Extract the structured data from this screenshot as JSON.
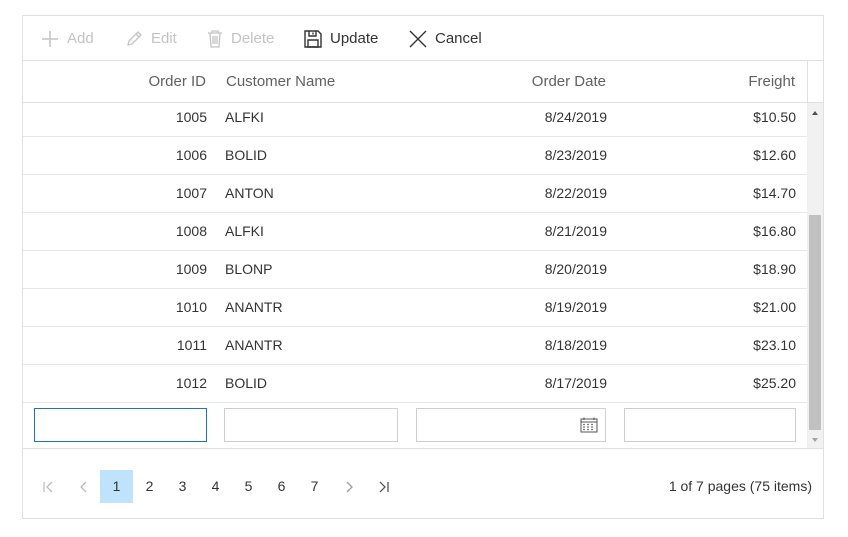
{
  "toolbar": {
    "add_label": "Add",
    "edit_label": "Edit",
    "delete_label": "Delete",
    "update_label": "Update",
    "cancel_label": "Cancel"
  },
  "columns": {
    "order_id": "Order ID",
    "customer_name": "Customer Name",
    "order_date": "Order Date",
    "freight": "Freight"
  },
  "rows": [
    {
      "id": "1005",
      "customer": "ALFKI",
      "date": "8/24/2019",
      "freight": "$10.50"
    },
    {
      "id": "1006",
      "customer": "BOLID",
      "date": "8/23/2019",
      "freight": "$12.60"
    },
    {
      "id": "1007",
      "customer": "ANTON",
      "date": "8/22/2019",
      "freight": "$14.70"
    },
    {
      "id": "1008",
      "customer": "ALFKI",
      "date": "8/21/2019",
      "freight": "$16.80"
    },
    {
      "id": "1009",
      "customer": "BLONP",
      "date": "8/20/2019",
      "freight": "$18.90"
    },
    {
      "id": "1010",
      "customer": "ANANTR",
      "date": "8/19/2019",
      "freight": "$21.00"
    },
    {
      "id": "1011",
      "customer": "ANANTR",
      "date": "8/18/2019",
      "freight": "$23.10"
    },
    {
      "id": "1012",
      "customer": "BOLID",
      "date": "8/17/2019",
      "freight": "$25.20"
    }
  ],
  "edit_row": {
    "order_id_value": "",
    "customer_value": "",
    "date_value": "",
    "freight_value": ""
  },
  "pager": {
    "pages": [
      "1",
      "2",
      "3",
      "4",
      "5",
      "6",
      "7"
    ],
    "active_page": "1",
    "info": "1 of 7 pages (75 items)"
  },
  "icons": {
    "add": "plus-icon",
    "edit": "pencil-icon",
    "delete": "trash-icon",
    "update": "save-icon",
    "cancel": "close-icon",
    "calendar": "calendar-icon",
    "first": "first-page-icon",
    "prev": "prev-page-icon",
    "next": "next-page-icon",
    "last": "last-page-icon"
  },
  "colors": {
    "accent": "#1e73be",
    "active_page_bg": "#bee3fb",
    "disabled_text": "#c4c4c4"
  }
}
